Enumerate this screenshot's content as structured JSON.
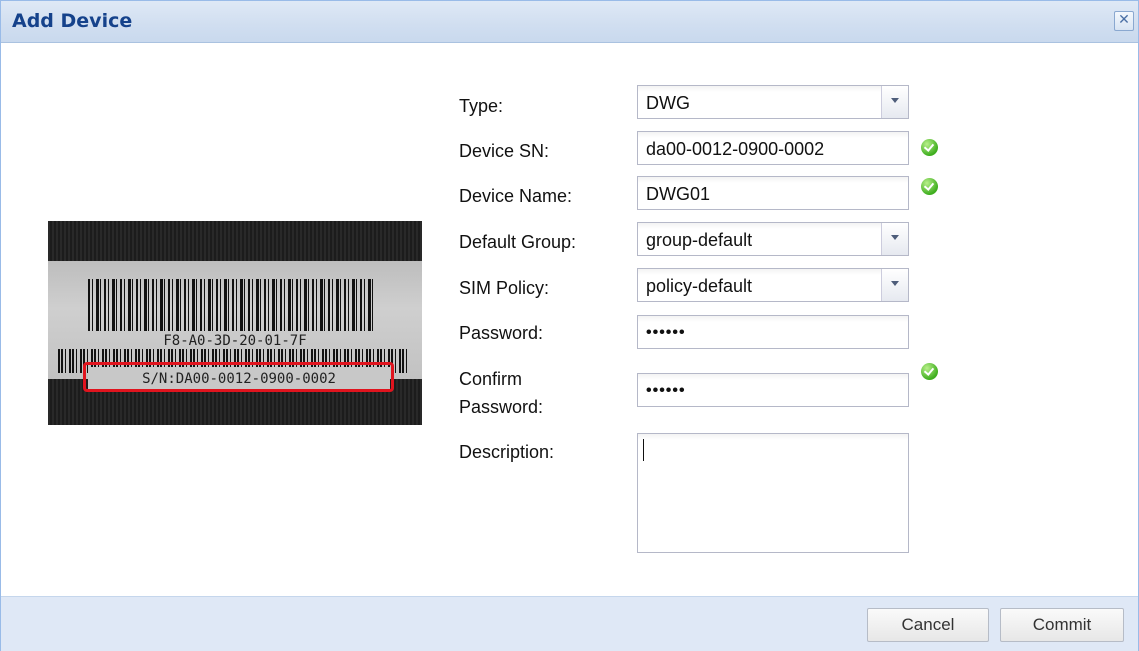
{
  "window": {
    "title": "Add Device",
    "close_symbol": "✕"
  },
  "photo": {
    "mac_text": "F8-A0-3D-20-01-7F",
    "sn_text": "S/N:DA00-0012-0900-0002"
  },
  "form": {
    "type": {
      "label": "Type:",
      "value": "DWG"
    },
    "device_sn": {
      "label": "Device SN:",
      "value": "da00-0012-0900-0002"
    },
    "device_name": {
      "label": "Device Name:",
      "value": "DWG01"
    },
    "default_group": {
      "label": "Default Group:",
      "value": "group-default"
    },
    "sim_policy": {
      "label": "SIM Policy:",
      "value": "policy-default"
    },
    "password": {
      "label": "Password:",
      "value": "••••••"
    },
    "confirm_password": {
      "label_line1": "Confirm",
      "label_line2": "Password:",
      "value": "••••••"
    },
    "description": {
      "label": "Description:",
      "value": ""
    }
  },
  "buttons": {
    "cancel": "Cancel",
    "commit": "Commit"
  },
  "colors": {
    "title": "#15428b",
    "titlebar": "#d0def0",
    "footer": "#dfe8f6",
    "valid": "#3fae1f",
    "highlight": "#e0141e"
  }
}
